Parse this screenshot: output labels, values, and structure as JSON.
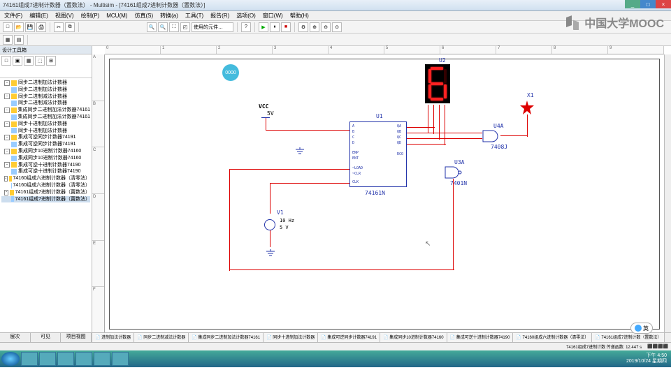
{
  "title": "74161组成7进制计数器（置数法） - Multisim - [74161组成7进制计数器（置数法）]",
  "watermark": "中国大学MOOC",
  "menu": [
    "文件(F)",
    "编辑(E)",
    "视图(V)",
    "绘制(P)",
    "MCU(M)",
    "仿真(S)",
    "转换(a)",
    "工具(T)",
    "报告(R)",
    "选项(O)",
    "窗口(W)",
    "帮助(H)"
  ],
  "toolbar_combo": "使用的元件…",
  "sidebar": {
    "header": "设计工具箱",
    "tabs": [
      "层次",
      "可见",
      "项目视图"
    ],
    "tree": [
      {
        "expand": "-",
        "label": "同步二进制加法计数器",
        "children": [
          "同步二进制加法计数器"
        ]
      },
      {
        "expand": "-",
        "label": "同步二进制减法计数器",
        "children": [
          "同步二进制减法计数器"
        ]
      },
      {
        "expand": "-",
        "label": "集成同步二进制加法计数器74161",
        "children": [
          "集成同步二进制加法计数器74161"
        ]
      },
      {
        "expand": "-",
        "label": "同步十进制加法计数器",
        "children": [
          "同步十进制加法计数器"
        ]
      },
      {
        "expand": "-",
        "label": "集成可逆同步计数器74191",
        "children": [
          "集成可逆同步计数器74191"
        ]
      },
      {
        "expand": "-",
        "label": "集成同步10进制计数器74160",
        "children": [
          "集成同步10进制计数器74160"
        ]
      },
      {
        "expand": "-",
        "label": "集成可逆十进制计数器74190",
        "children": [
          "集成可逆十进制计数器74190"
        ]
      },
      {
        "expand": "-",
        "label": "74160组成六进制计数器（清零法）",
        "children": [
          "74160组成六进制计数器（清零法）"
        ]
      },
      {
        "expand": "-",
        "label": "74161组成7进制计数器（置数法）",
        "children": [
          "74161组成7进制计数器（置数法）"
        ],
        "selected": true
      }
    ]
  },
  "schematic": {
    "vcc": "VCC",
    "vcc_val": "5V",
    "u1_ref": "U1",
    "u1_part": "74161N",
    "u2_ref": "U2",
    "u3_ref": "U3A",
    "u3_part": "7401N",
    "u4_ref": "U4A",
    "u4_part": "7408J",
    "x1_ref": "X1",
    "v1_ref": "V1",
    "v1_freq": "10 Hz",
    "v1_amp": "5 V",
    "pins_left": [
      "A",
      "B",
      "C",
      "D",
      "ENP",
      "ENT",
      "~LOAD",
      "~CLR",
      "CLK"
    ],
    "pins_right": [
      "QA",
      "QB",
      "QC",
      "QD",
      "RCO"
    ],
    "display_digit": "6"
  },
  "tabs": [
    "进制加法计数器",
    "同步二进制减法计数器",
    "集成同步二进制加法计数器74161",
    "同步十进制加法计数器",
    "集成可逆同步计数器74191",
    "集成同步10进制计数器74160",
    "集成可逆十进制计数器74190",
    "74160组成六进制计数器（清零法）",
    "74161组成7进制计数（置数法）"
  ],
  "status": {
    "left": "74161组成7进制计数 传递函数: 12.447 s",
    "right": ""
  },
  "help_btn": "英",
  "tray": {
    "time": "下午 4:50",
    "date": "2019/10/24 星期四"
  },
  "bubble": "0000",
  "ruler_h": [
    "0",
    "1",
    "2",
    "3",
    "4",
    "5",
    "6",
    "7",
    "8",
    "9"
  ],
  "ruler_v": [
    "A",
    "B",
    "C",
    "D",
    "E",
    "F"
  ]
}
